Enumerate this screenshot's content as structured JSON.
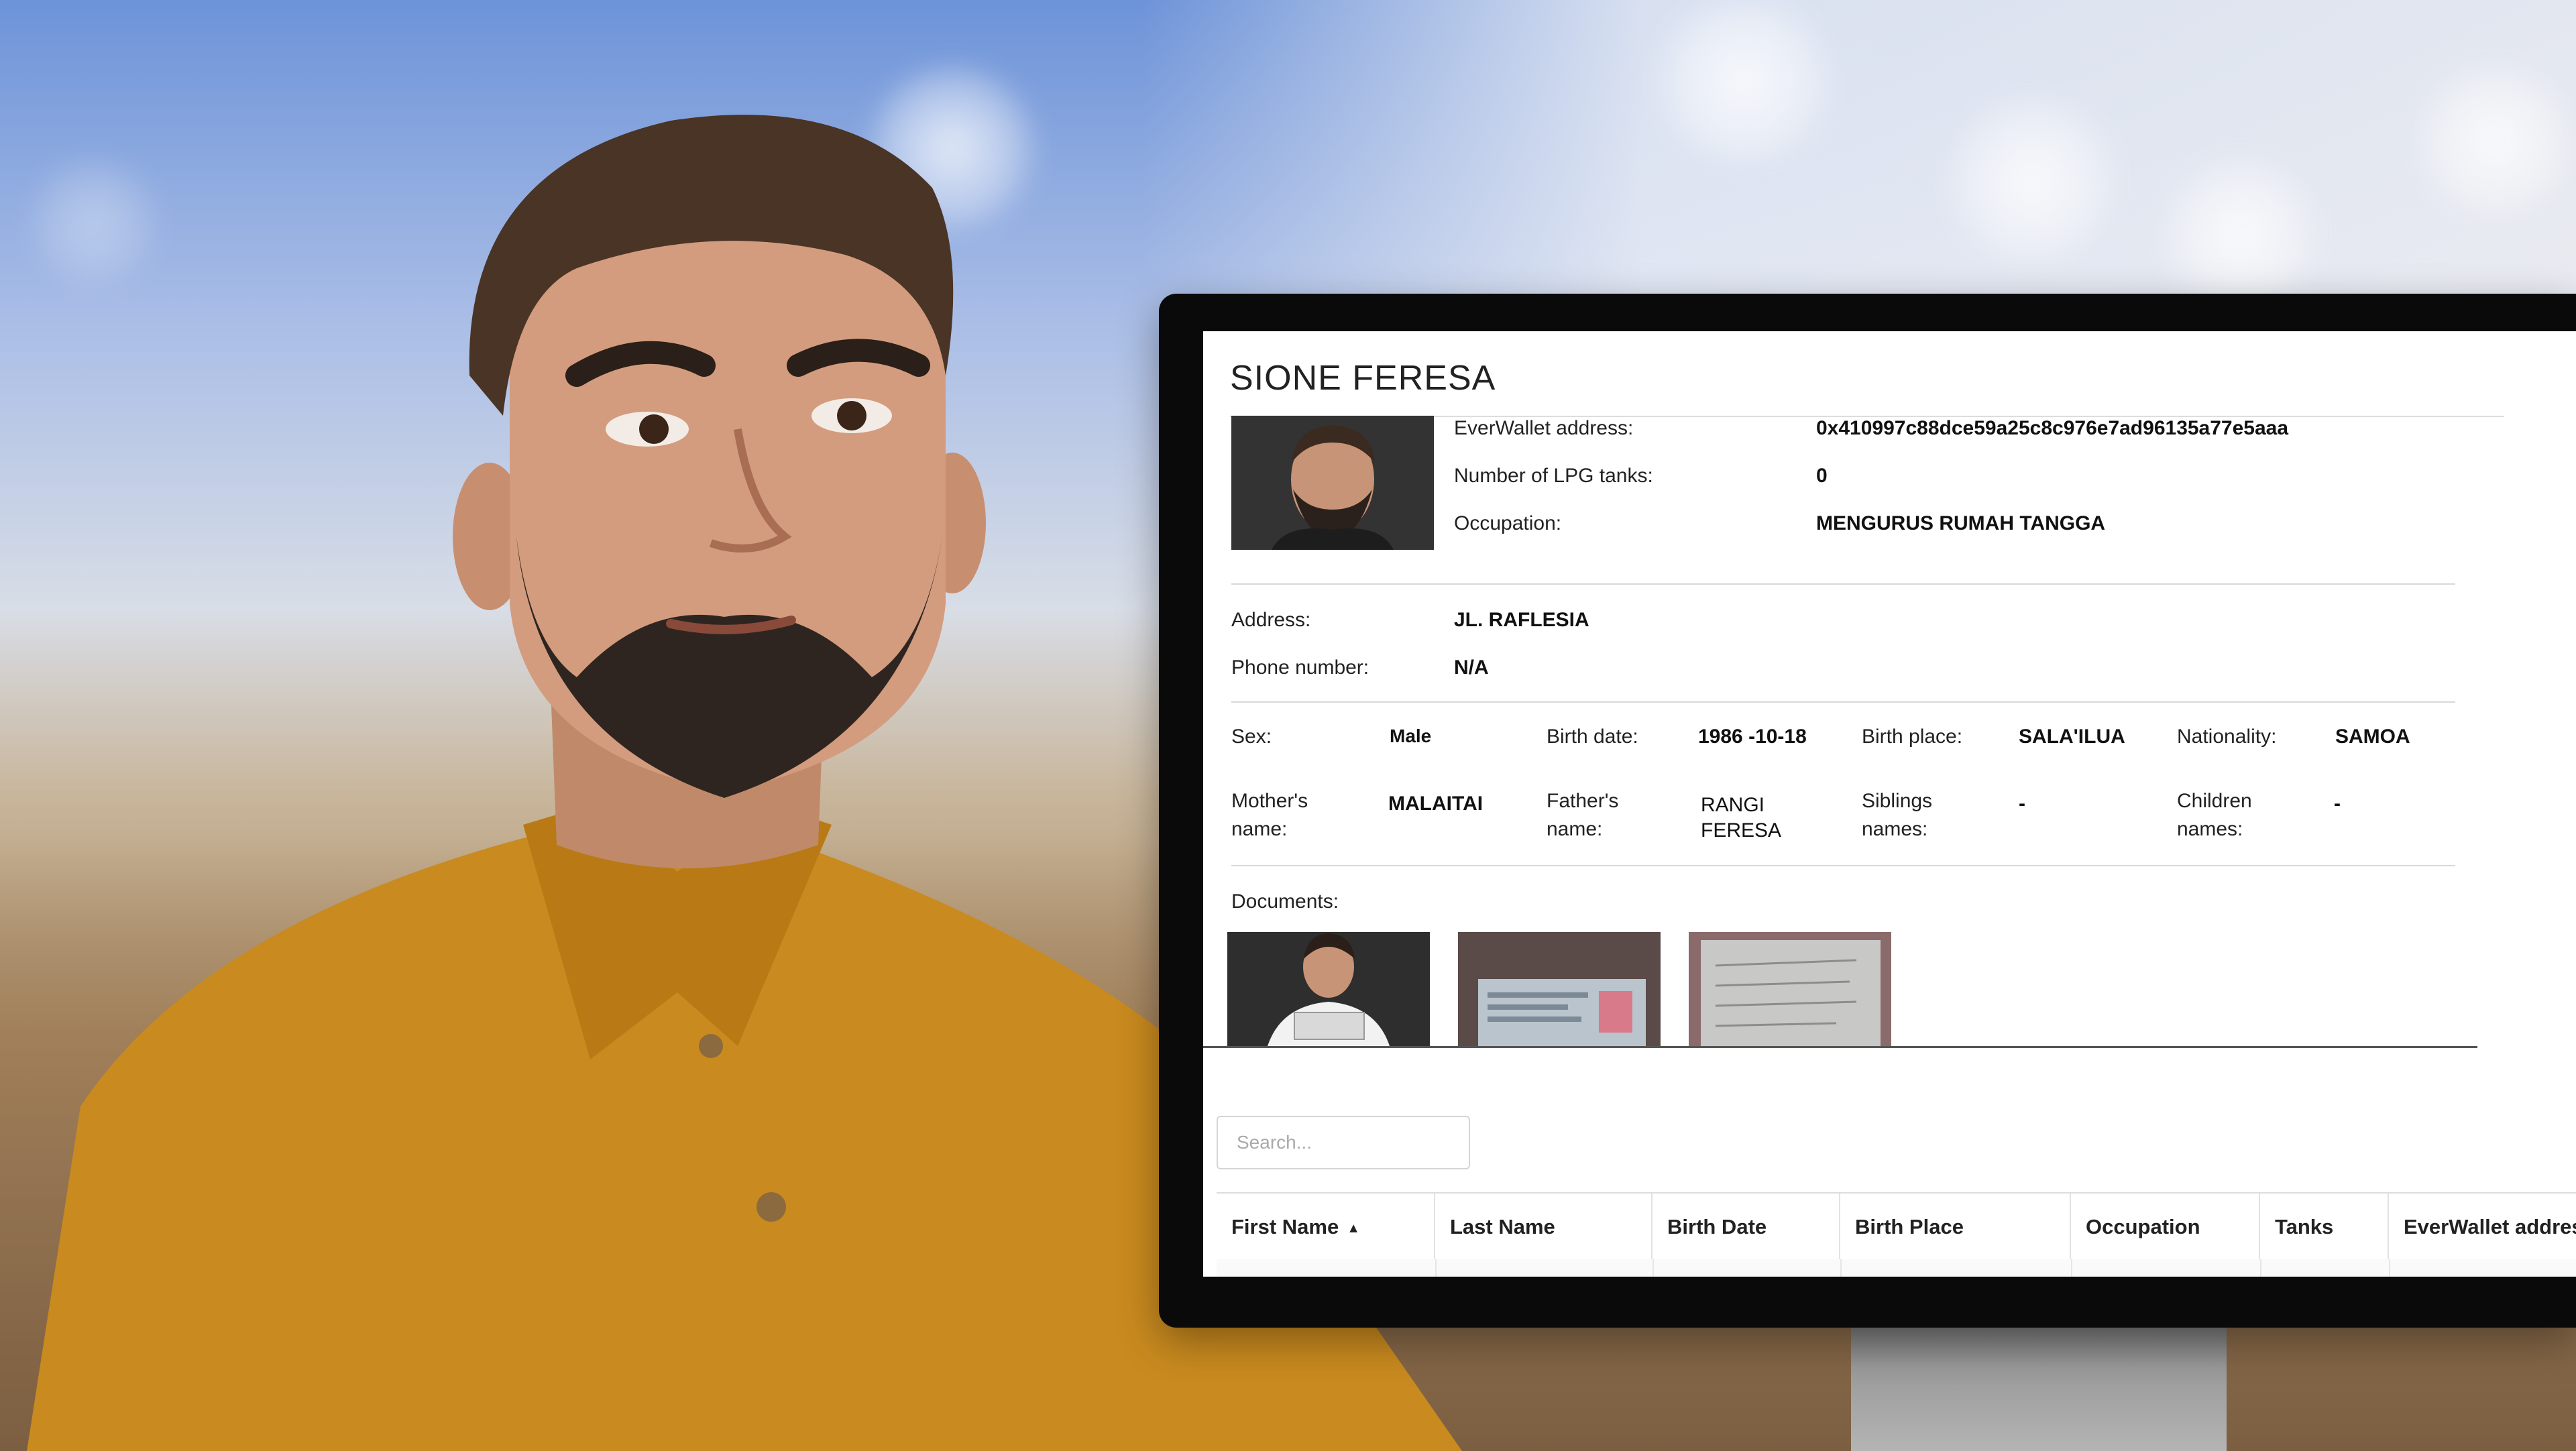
{
  "profile": {
    "name": "SIONE FERESA",
    "everwallet_label": "EverWallet address:",
    "everwallet_value": "0x410997c88dce59a25c8c976e7ad96135a77e5aaa",
    "lpg_label": "Number of LPG tanks:",
    "lpg_value": "0",
    "occupation_label": "Occupation:",
    "occupation_value": "MENGURUS RUMAH TANGGA",
    "address_label": "Address:",
    "address_value": "JL. RAFLESIA",
    "phone_label": "Phone number:",
    "phone_value": "N/A",
    "sex_label": "Sex:",
    "sex_value": "Male",
    "birth_date_label": "Birth date:",
    "birth_date_value": "1986 -10-18",
    "birth_place_label": "Birth place:",
    "birth_place_value": "SALA'ILUA",
    "nationality_label": "Nationality:",
    "nationality_value": "SAMOA",
    "mother_label_1": "Mother's",
    "mother_label_2": "name:",
    "mother_value": "MALAITAI",
    "father_label_1": "Father's",
    "father_label_2": "name:",
    "father_value_1": "RANGI",
    "father_value_2": "FERESA",
    "siblings_label_1": "Siblings",
    "siblings_label_2": "names:",
    "siblings_value": "-",
    "children_label_1": "Children",
    "children_label_2": "names:",
    "children_value": "-",
    "documents_label": "Documents:"
  },
  "search": {
    "placeholder": "Search..."
  },
  "table": {
    "columns": [
      "First Name",
      "Last Name",
      "Birth Date",
      "Birth Place",
      "Occupation",
      "Tanks",
      "EverWallet addres"
    ],
    "sorted_column_icon": "sort-up-icon"
  }
}
